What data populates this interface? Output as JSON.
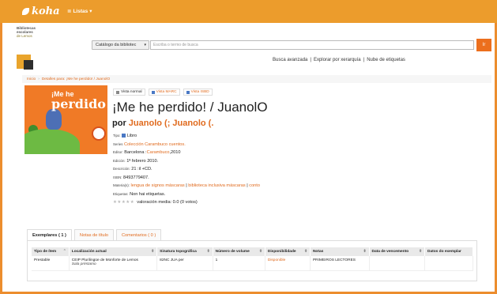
{
  "topbar": {
    "logo_text": "koha",
    "lists_label": "Listas",
    "lists_chevron": "▾"
  },
  "library_logo": {
    "line1": "Bibliotecas",
    "line2": "escolares",
    "line3": "de Lemos"
  },
  "search": {
    "scope_selected": "Catálogo da bibliotec",
    "placeholder": "Escriba o termo de busca",
    "button_label": "Ir"
  },
  "search_links": {
    "advanced": "Busca avanzada",
    "sep1": "|",
    "hierarchy": "Explorar por xerarquía",
    "sep2": "|",
    "tags": "Nube de etiquetas"
  },
  "breadcrumb": {
    "home": "Inicio",
    "sep": "›",
    "current": "Detalles para: ¡Me he perdido! / JuanolO"
  },
  "cover": {
    "line1": "¡Me he",
    "line2": "perdido!"
  },
  "views": {
    "normal": "Vista normal",
    "marc": "Vista MARC",
    "isbd": "Vista ISBD"
  },
  "record": {
    "title": "¡Me he perdido! / JuanolO",
    "author_prefix": "por",
    "author1": "Juanolo",
    "author_mid": "(;",
    "author2": "Juanolo",
    "author_end": "(.",
    "type_label": "Tipo:",
    "type_value": "Libro",
    "series_label": "Series",
    "series_value": "Colección Carambuco cuentos.",
    "publisher_label": "Editor:",
    "publisher_place": "Barcelona :",
    "publisher_name": "Carambuco",
    "publisher_year": ",2010",
    "edition_label": "Edición:",
    "edition_value": "1ª febrero 2010.",
    "description_label": "Descrición:",
    "description_value": "21 :il +CD.",
    "isbn_label": "ISBN:",
    "isbn_value": "8493779407.",
    "subjects_label": "Materia(s):",
    "subject1": "lengua de signos máscaras",
    "subject_sep1": "|",
    "subject2": "biblioteca inclusiva máscaras",
    "subject_sep2": "|",
    "subject3": "conto",
    "tags_label": "Etiquetas:",
    "tags_value": "Non hai etiquetas.",
    "stars": "★★★★★",
    "rating_text": "valoración media: 0.0 (0 votos)"
  },
  "tabs": [
    {
      "label": "Exemplares ( 1 )"
    },
    {
      "label": "Notas de título"
    },
    {
      "label": "Comentarios ( 0 )"
    }
  ],
  "holdings": {
    "headers": [
      "Tipo de ítem",
      "Localización actual",
      "Sinatura topográfica",
      "Número de volume",
      "Disponibilidade",
      "Notas",
      "Data de vencemento",
      "Datos do exemplar"
    ],
    "rows": [
      {
        "item_type": "Prestable",
        "location": "CEIP Plurilingüe de Monforte de Lemos",
        "sublocation": "Sala préstamo",
        "call_number": "82NC JUA per",
        "volume": "1",
        "availability": "Disponible",
        "notes": "PRIMEIROS LECTORES",
        "due_date": "",
        "item_info": ""
      }
    ]
  }
}
